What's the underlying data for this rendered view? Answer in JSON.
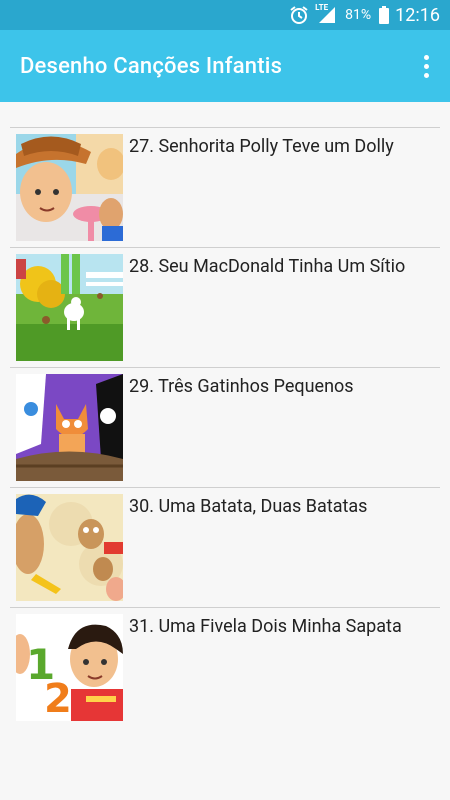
{
  "status_bar": {
    "network": "LTE",
    "battery": "81%",
    "time": "12:16"
  },
  "app_bar": {
    "title": "Desenho Canções Infantis"
  },
  "songs": [
    {
      "label": "27. Senhorita Polly Teve um Dolly"
    },
    {
      "label": "28. Seu MacDonald Tinha Um Sítio"
    },
    {
      "label": "29. Três Gatinhos Pequenos"
    },
    {
      "label": "30. Uma Batata, Duas Batatas"
    },
    {
      "label": "31. Uma Fivela Dois Minha Sapata"
    }
  ],
  "thumbnail_text": {
    "digit_1": "1",
    "digit_2": "2"
  },
  "colors": {
    "status_bar": "#2aa7ce",
    "app_bar": "#3dc4ea",
    "background": "#f7f7f7",
    "divider": "#cfcfcf"
  }
}
